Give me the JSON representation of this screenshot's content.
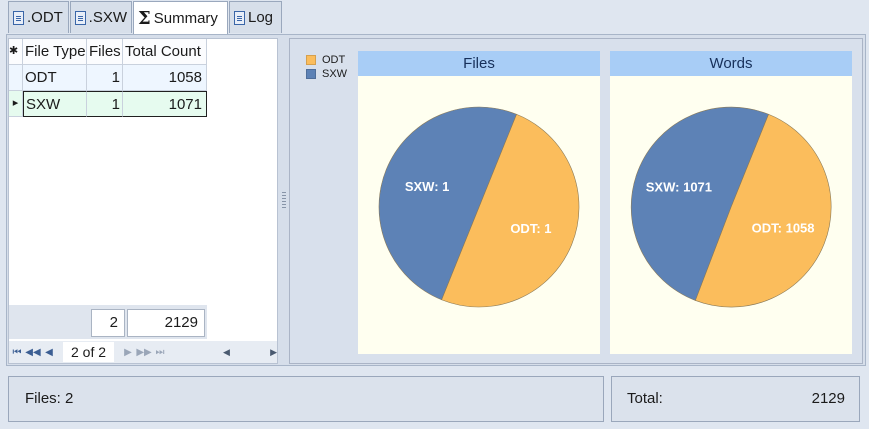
{
  "tabs": [
    {
      "label": ".ODT",
      "icon": "odt-doc-icon"
    },
    {
      "label": ".SXW",
      "icon": "sxw-doc-icon"
    },
    {
      "label": "Summary",
      "icon": "sigma-icon",
      "active": true
    },
    {
      "label": "Log",
      "icon": "log-doc-icon"
    }
  ],
  "grid": {
    "header": {
      "marker": "✱",
      "col1": "File Type",
      "col2": "Files",
      "col3": "Total Count"
    },
    "rows": [
      {
        "marker": "",
        "type": "ODT",
        "files": "1",
        "count": "1058"
      },
      {
        "marker": "▸",
        "type": "SXW",
        "files": "1",
        "count": "1071"
      }
    ],
    "footer": {
      "files_total": "2",
      "count_total": "2129"
    },
    "nav": {
      "first": "⏮",
      "prev_page": "◀◀",
      "prev": "◀",
      "position": "2 of 2",
      "next": "▶",
      "next_page": "▶▶",
      "last": "⏭"
    },
    "scroll": {
      "left": "◀",
      "right": "▶"
    }
  },
  "legend": [
    {
      "label": "ODT",
      "color": "#fbbd5c"
    },
    {
      "label": "SXW",
      "color": "#5d82b6"
    }
  ],
  "chart_data": [
    {
      "type": "pie",
      "title": "Files",
      "categories": [
        "ODT",
        "SXW"
      ],
      "values": [
        1,
        1
      ],
      "labels": [
        "ODT: 1",
        "SXW: 1"
      ],
      "colors": [
        "#fbbd5c",
        "#5d82b6"
      ]
    },
    {
      "type": "pie",
      "title": "Words",
      "categories": [
        "ODT",
        "SXW"
      ],
      "values": [
        1058,
        1071
      ],
      "labels": [
        "ODT: 1058",
        "SXW: 1071"
      ],
      "colors": [
        "#fbbd5c",
        "#5d82b6"
      ]
    }
  ],
  "status": {
    "files": "Files: 2",
    "total_label": "Total:",
    "total_value": "2129"
  }
}
